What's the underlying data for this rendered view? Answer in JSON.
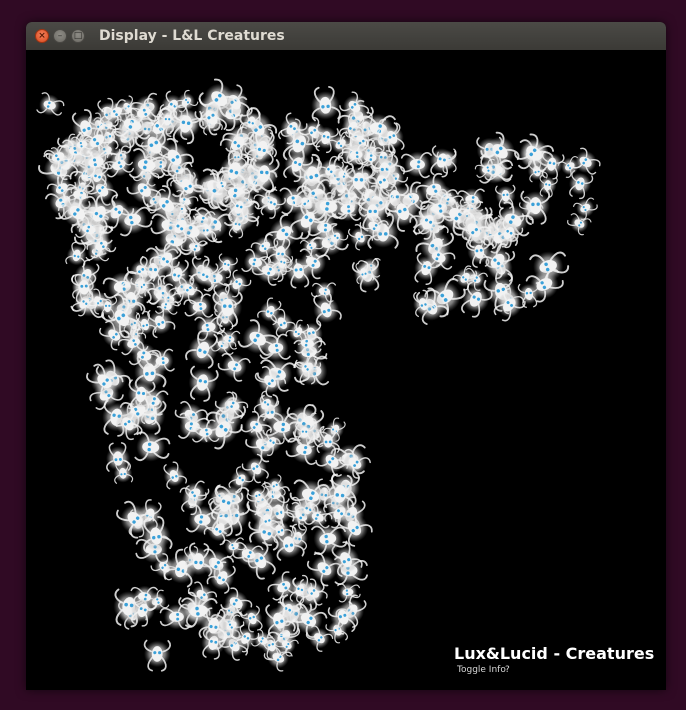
{
  "window": {
    "title": "Display - L&L Creatures",
    "close_glyph": "×",
    "minimize_glyph": "–",
    "maximize_glyph": "□"
  },
  "canvas": {
    "background": "#000000",
    "creature_color": "#f2f2f2",
    "creature_eye_color": "#3aa0d8",
    "brand_title": "Lux&Lucid - Creatures",
    "toggle_info_label": "Toggle Info",
    "help_label": "?"
  },
  "colors": {
    "desktop": "#300a24",
    "titlebar": "#3c3b37",
    "close_button": "#e65d30"
  }
}
